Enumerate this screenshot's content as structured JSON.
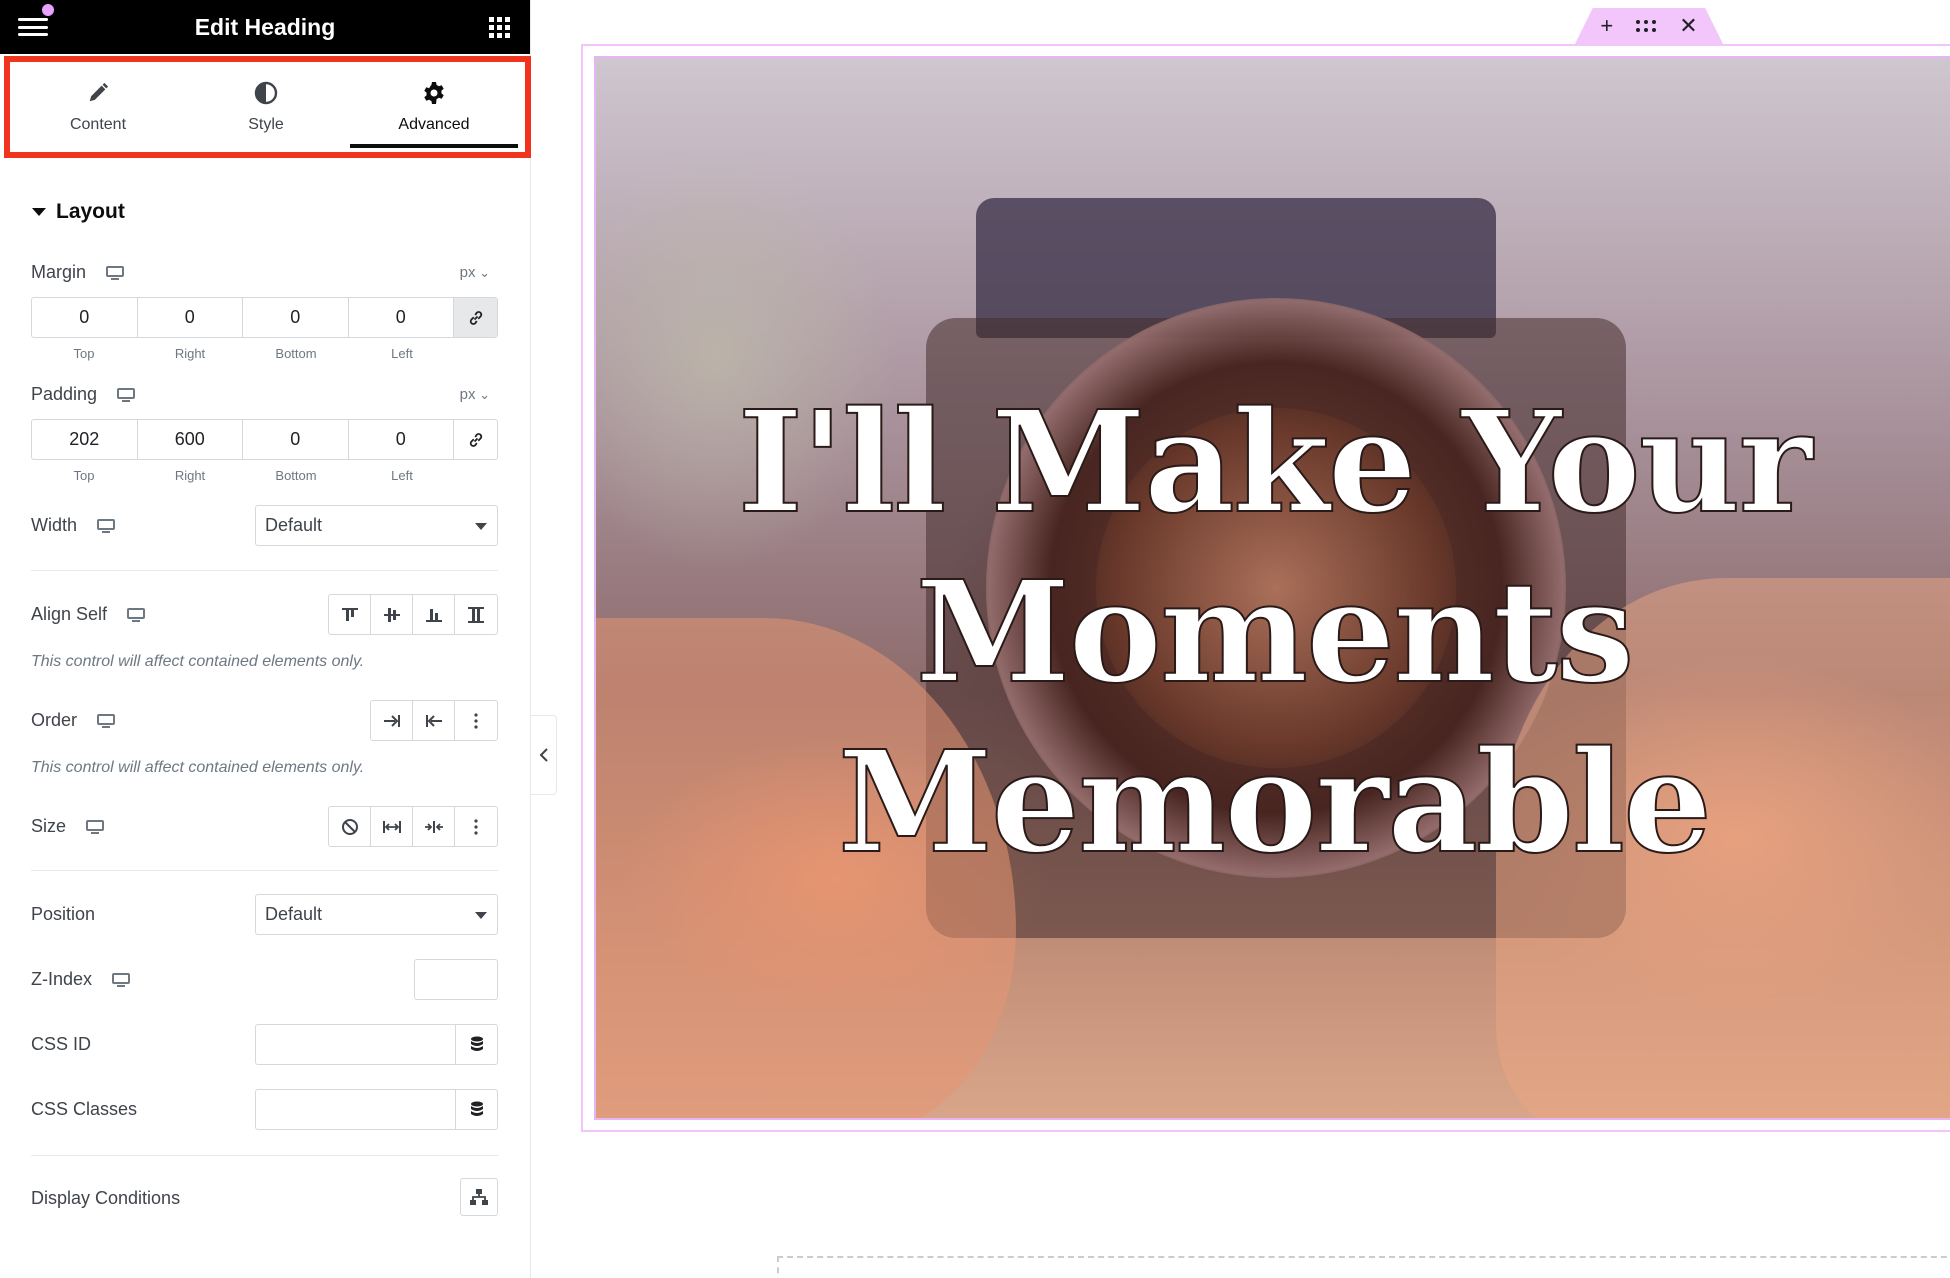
{
  "header": {
    "title": "Edit Heading"
  },
  "tabs": [
    {
      "label": "Content",
      "icon": "pencil-icon"
    },
    {
      "label": "Style",
      "icon": "contrast-icon"
    },
    {
      "label": "Advanced",
      "icon": "gear-icon"
    }
  ],
  "active_tab": "Advanced",
  "section": {
    "title": "Layout"
  },
  "margin": {
    "label": "Margin",
    "unit": "px",
    "values": [
      "0",
      "0",
      "0",
      "0"
    ],
    "sides": [
      "Top",
      "Right",
      "Bottom",
      "Left"
    ],
    "linked": true
  },
  "padding": {
    "label": "Padding",
    "unit": "px",
    "values": [
      "202",
      "600",
      "0",
      "0"
    ],
    "sides": [
      "Top",
      "Right",
      "Bottom",
      "Left"
    ],
    "linked": false
  },
  "width": {
    "label": "Width",
    "value": "Default"
  },
  "align_self": {
    "label": "Align Self",
    "note": "This control will affect contained elements only."
  },
  "order": {
    "label": "Order",
    "note": "This control will affect contained elements only."
  },
  "size": {
    "label": "Size"
  },
  "position": {
    "label": "Position",
    "value": "Default"
  },
  "z_index": {
    "label": "Z-Index",
    "value": ""
  },
  "css_id": {
    "label": "CSS ID",
    "value": ""
  },
  "css_classes": {
    "label": "CSS Classes",
    "value": ""
  },
  "display_conditions": {
    "label": "Display Conditions"
  },
  "canvas": {
    "heading": "I'll Make Your Moments Memorable",
    "toolbar": {
      "add": "+",
      "close": "✕"
    }
  },
  "colors": {
    "highlight": "#f0341d",
    "container_outline": "#f2c6fa",
    "topbar": "#000000"
  }
}
